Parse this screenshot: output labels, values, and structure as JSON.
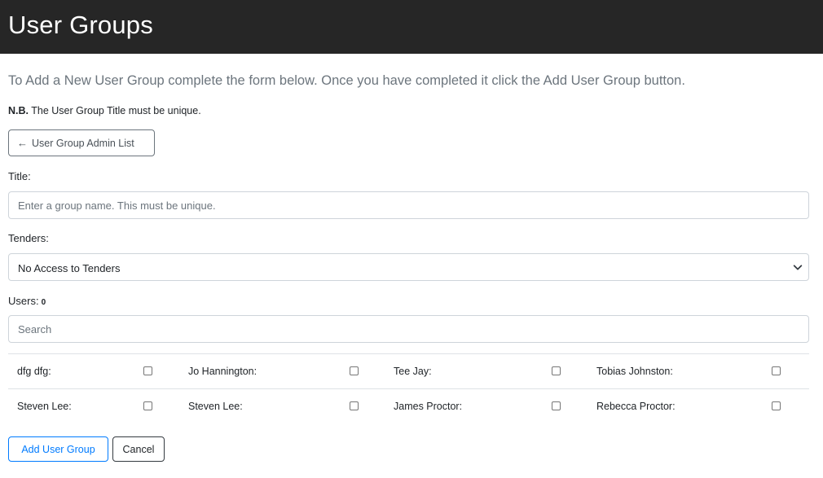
{
  "header": {
    "title": "User Groups"
  },
  "intro": {
    "text": "To Add a New User Group complete the form below. Once you have completed it click the Add User Group button.",
    "note_bold": "N.B.",
    "note_text": " The User Group Title must be unique."
  },
  "back_button": {
    "arrow": "←",
    "label": "User Group Admin List",
    "icon": "arrow-left-icon"
  },
  "title_field": {
    "label": "Title:",
    "value": "",
    "placeholder": "Enter a group name. This must be unique."
  },
  "tenders_field": {
    "label": "Tenders:",
    "selected": "No Access to Tenders",
    "icon": "chevron-down-icon"
  },
  "users": {
    "label": "Users:",
    "count": "0",
    "search_placeholder": "Search",
    "rows": [
      [
        {
          "name": "dfg dfg:",
          "checked": false
        },
        {
          "name": "Jo Hannington:",
          "checked": false
        },
        {
          "name": "Tee Jay:",
          "checked": false
        },
        {
          "name": "Tobias Johnston:",
          "checked": false
        }
      ],
      [
        {
          "name": "Steven Lee:",
          "checked": false
        },
        {
          "name": "Steven Lee:",
          "checked": false
        },
        {
          "name": "James Proctor:",
          "checked": false
        },
        {
          "name": "Rebecca Proctor:",
          "checked": false
        }
      ]
    ]
  },
  "actions": {
    "add_label": "Add User Group",
    "cancel_label": "Cancel"
  }
}
